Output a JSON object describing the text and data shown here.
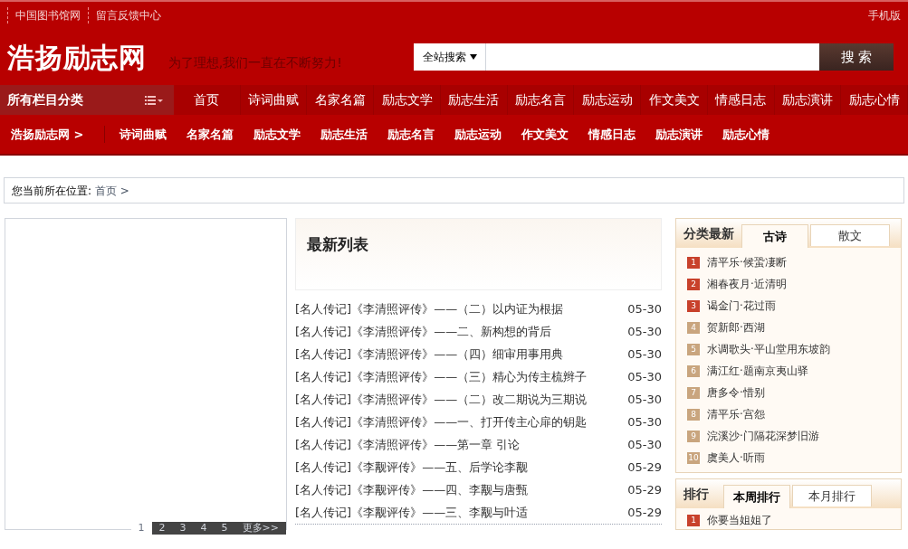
{
  "top_links": [
    "中国图书馆网",
    "留言反馈中心"
  ],
  "mobile_link": "手机版",
  "logo": "浩扬励志网",
  "slogan": "为了理想,我们一直在不断努力!",
  "search": {
    "scope": "全站搜索",
    "button": "搜 索"
  },
  "category_button": "所有栏目分类",
  "main_nav": [
    "首页",
    "诗词曲赋",
    "名家名篇",
    "励志文学",
    "励志生活",
    "励志名言",
    "励志运动",
    "作文美文",
    "情感日志",
    "励志演讲",
    "励志心情"
  ],
  "sub_nav": {
    "home": "浩扬励志网 >",
    "items": [
      "诗词曲赋",
      "名家名篇",
      "励志文学",
      "励志生活",
      "励志名言",
      "励志运动",
      "作文美文",
      "情感日志",
      "励志演讲",
      "励志心情"
    ]
  },
  "breadcrumb": {
    "label": "您当前所在位置:",
    "path": "首页 >"
  },
  "pagination": [
    {
      "label": "1",
      "selected": true
    },
    {
      "label": "2",
      "selected": false
    },
    {
      "label": "3",
      "selected": false
    },
    {
      "label": "4",
      "selected": false
    },
    {
      "label": "5",
      "selected": false
    },
    {
      "label": "更多>>",
      "selected": false
    }
  ],
  "latest": {
    "title": "最新列表",
    "items": [
      {
        "title": "[名人传记]《李清照评传》——（二）以内证为根据",
        "date": "05-30"
      },
      {
        "title": "[名人传记]《李清照评传》——二、新构想的背后",
        "date": "05-30"
      },
      {
        "title": "[名人传记]《李清照评传》——（四）细审用事用典",
        "date": "05-30"
      },
      {
        "title": "[名人传记]《李清照评传》——（三）精心为传主梳辫子",
        "date": "05-30"
      },
      {
        "title": "[名人传记]《李清照评传》——（二）改二期说为三期说",
        "date": "05-30"
      },
      {
        "title": "[名人传记]《李清照评传》——一、打开传主心扉的钥匙",
        "date": "05-30"
      },
      {
        "title": "[名人传记]《李清照评传》——第一章 引论",
        "date": "05-30"
      },
      {
        "title": "[名人传记]《李觏评传》——五、后学论李觏",
        "date": "05-29"
      },
      {
        "title": "[名人传记]《李觏评传》——四、李觏与唐甄",
        "date": "05-29"
      },
      {
        "title": "[名人传记]《李觏评传》——三、李觏与叶适",
        "date": "05-29"
      }
    ]
  },
  "category_latest": {
    "title": "分类最新",
    "tabs": [
      {
        "label": "古诗",
        "selected": true
      },
      {
        "label": "散文",
        "selected": false
      }
    ],
    "items": [
      {
        "rank": "1",
        "title": "清平乐·候蛩凄断",
        "color": "#c8412b"
      },
      {
        "rank": "2",
        "title": "湘春夜月·近清明",
        "color": "#c8412b"
      },
      {
        "rank": "3",
        "title": "谒金门·花过雨",
        "color": "#c8412b"
      },
      {
        "rank": "4",
        "title": "贺新郎·西湖",
        "color": "#c9a57e"
      },
      {
        "rank": "5",
        "title": "水调歌头·平山堂用东坡韵",
        "color": "#c9a57e"
      },
      {
        "rank": "6",
        "title": "满江红·题南京夷山驿",
        "color": "#c9a57e"
      },
      {
        "rank": "7",
        "title": "唐多令·惜别",
        "color": "#c9a57e"
      },
      {
        "rank": "8",
        "title": "清平乐·宫怨",
        "color": "#c9a57e"
      },
      {
        "rank": "9",
        "title": "浣溪沙·门隔花深梦旧游",
        "color": "#c9a57e"
      },
      {
        "rank": "10",
        "title": "虞美人·听雨",
        "color": "#c9a57e"
      }
    ]
  },
  "ranking": {
    "title": "排行",
    "tabs": [
      {
        "label": "本周排行",
        "selected": true
      },
      {
        "label": "本月排行",
        "selected": false
      }
    ],
    "items": [
      {
        "rank": "1",
        "title": "你要当姐姐了",
        "color": "#c8412b"
      }
    ]
  }
}
